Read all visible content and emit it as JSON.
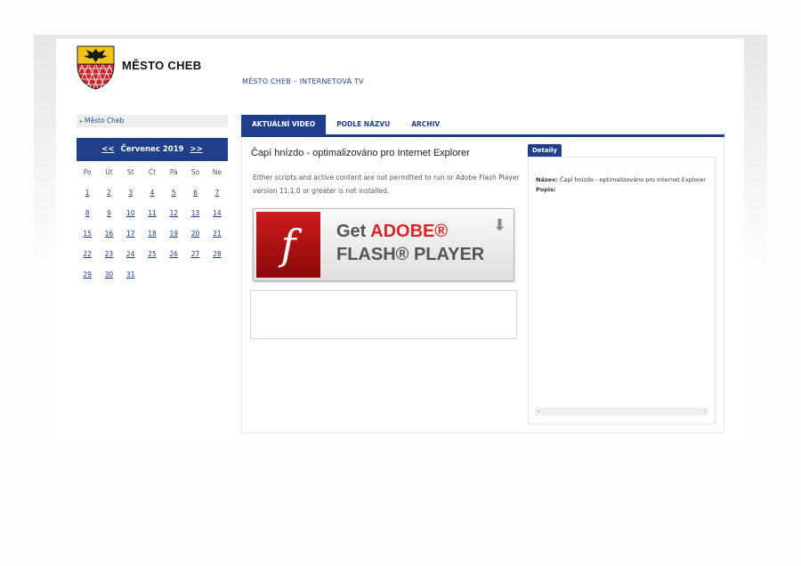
{
  "header": {
    "brand": "MĚSTO CHEB",
    "subtitle": "MĚSTO CHEB – INTERNETOVÁ TV"
  },
  "sidebar": {
    "link_label": "Město Cheb"
  },
  "calendar": {
    "prev": "<<",
    "next": ">>",
    "month_label": "Červenec 2019",
    "weekdays": [
      "Po",
      "Út",
      "St",
      "Čt",
      "Pá",
      "So",
      "Ne"
    ],
    "weeks": [
      [
        "1",
        "2",
        "3",
        "4",
        "5",
        "6",
        "7"
      ],
      [
        "8",
        "9",
        "10",
        "11",
        "12",
        "13",
        "14"
      ],
      [
        "15",
        "16",
        "17",
        "18",
        "19",
        "20",
        "21"
      ],
      [
        "22",
        "23",
        "24",
        "25",
        "26",
        "27",
        "28"
      ],
      [
        "29",
        "30",
        "31",
        "",
        "",
        "",
        ""
      ]
    ]
  },
  "tabs": [
    {
      "label": "AKTUÁLNÍ VIDEO",
      "active": true
    },
    {
      "label": "PODLE NÁZVU",
      "active": false
    },
    {
      "label": "ARCHIV",
      "active": false
    }
  ],
  "video": {
    "title": "Čapí hnízdo - optimalizováno pro Internet Explorer",
    "message": "Either scripts and active content are not permitted to run or Adobe Flash Player version 11.1.0 or greater is not installed."
  },
  "flash_badge": {
    "get": "Get",
    "adobe": "ADOBE®",
    "player": "FLASH® PLAYER",
    "icon_glyph": "f",
    "download_glyph": "⬇"
  },
  "details": {
    "tab_label": "Detaily",
    "name_label": "Název:",
    "name_value": "Čapí hnízdo - optimalizováno pro Internet Explorer",
    "desc_label": "Popis:",
    "desc_value": "",
    "scroll_left": "‹",
    "scroll_right": "›"
  },
  "colors": {
    "primary": "#1f3f8a",
    "flash_red": "#cf1c1c"
  }
}
